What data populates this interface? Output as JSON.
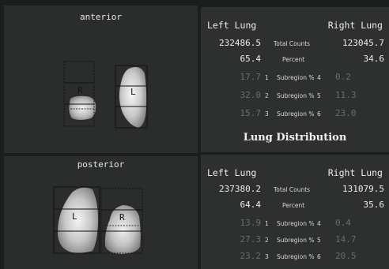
{
  "anterior": {
    "title": "anterior",
    "labels": {
      "right": "R",
      "left": "L"
    },
    "left_lung": "Left Lung",
    "right_lung": "Right Lung",
    "total_counts_label": "Total Counts",
    "left_total": "232486.5",
    "right_total": "123045.7",
    "percent_label": "Percent",
    "left_percent": "65.4",
    "right_percent": "34.6",
    "subregions": [
      {
        "left_value": "17.7",
        "left_num": "1",
        "label": "Subregion %",
        "right_num": "4",
        "right_value": "0.2"
      },
      {
        "left_value": "32.0",
        "left_num": "2",
        "label": "Subregion %",
        "right_num": "5",
        "right_value": "11.3"
      },
      {
        "left_value": "15.7",
        "left_num": "3",
        "label": "Subregion %",
        "right_num": "6",
        "right_value": "23.0"
      }
    ]
  },
  "distribution_title": "Lung Distribution",
  "posterior": {
    "title": "posterior",
    "labels": {
      "left": "L",
      "right": "R"
    },
    "left_lung": "Left Lung",
    "right_lung": "Right Lung",
    "total_counts_label": "Total Counts",
    "left_total": "237380.2",
    "right_total": "131079.5",
    "percent_label": "Percent",
    "left_percent": "64.4",
    "right_percent": "35.6",
    "subregions": [
      {
        "left_value": "13.9",
        "left_num": "1",
        "label": "Subregion %",
        "right_num": "4",
        "right_value": "0.4"
      },
      {
        "left_value": "27.3",
        "left_num": "2",
        "label": "Subregion %",
        "right_num": "5",
        "right_value": "14.7"
      },
      {
        "left_value": "23.2",
        "left_num": "3",
        "label": "Subregion %",
        "right_num": "6",
        "right_value": "20.5"
      }
    ]
  }
}
